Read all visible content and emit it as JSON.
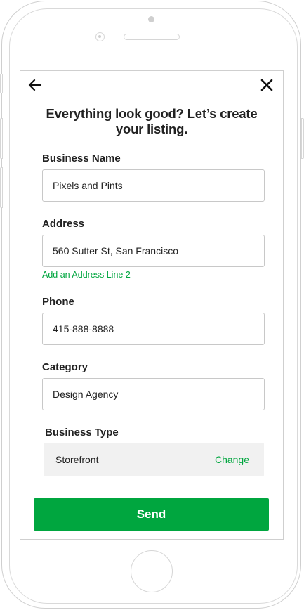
{
  "heading": "Everything look good? Let’s create your listing.",
  "fields": {
    "business_name": {
      "label": "Business Name",
      "value": "Pixels and Pints"
    },
    "address": {
      "label": "Address",
      "value": "560 Sutter St, San Francisco",
      "line2_link": "Add an Address Line 2"
    },
    "phone": {
      "label": "Phone",
      "value": "415-888-8888"
    },
    "category": {
      "label": "Category",
      "value": "Design Agency"
    }
  },
  "business_type": {
    "label": "Business Type",
    "value": "Storefront",
    "change_label": "Change"
  },
  "send_label": "Send",
  "colors": {
    "accent": "#00a63f",
    "text": "#222222",
    "field_border": "#c8c8c8",
    "panel_bg": "#f1f1f1"
  },
  "icons": {
    "back": "arrow-left-icon",
    "close": "close-icon"
  }
}
